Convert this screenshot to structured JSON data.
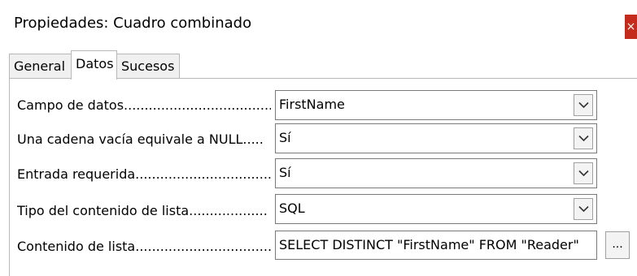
{
  "window": {
    "title": "Propiedades: Cuadro combinado",
    "close_glyph": "×"
  },
  "tabs": [
    {
      "label": "General",
      "active": false
    },
    {
      "label": "Datos",
      "active": true
    },
    {
      "label": "Sucesos",
      "active": false
    }
  ],
  "fields": {
    "campo_datos": {
      "label": "Campo de datos......................................",
      "value": "FirstName"
    },
    "cadena_vacia": {
      "label": "Una cadena vacía equivale a NULL.....",
      "value": "Sí"
    },
    "entrada_requerida": {
      "label": "Entrada requerida.................................",
      "value": "Sí"
    },
    "tipo_contenido": {
      "label": "Tipo del contenido de lista...................",
      "value": "SQL"
    },
    "contenido_lista": {
      "label": "Contenido de lista.................................",
      "value": "SELECT DISTINCT \"FirstName\" FROM \"Reader\"",
      "button": "..."
    }
  }
}
